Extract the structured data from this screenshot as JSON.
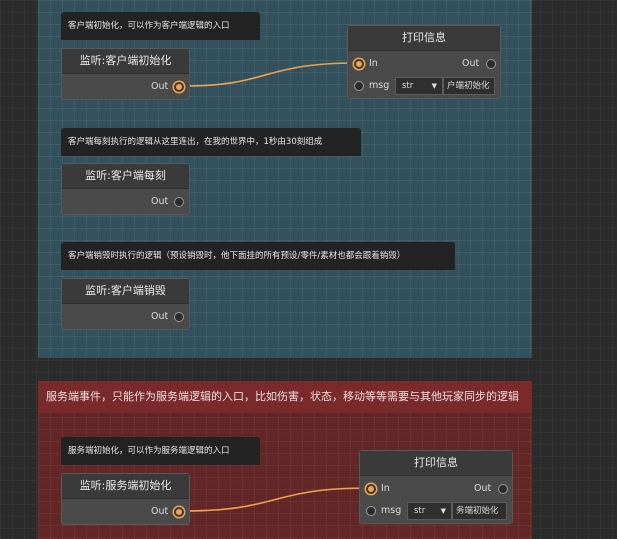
{
  "server_region": {
    "header": "服务端事件，只能作为服务端逻辑的入口，比如伤害，状态，移动等等需要与其他玩家同步的逻辑"
  },
  "comments": {
    "client_init": "客户端初始化，可以作为客户端逻辑的入口",
    "client_tick": "客户端每刻执行的逻辑从这里连出，在我的世界中，1秒由30刻组成",
    "client_destroy": "客户端销毁时执行的逻辑（预设销毁时，他下面挂的所有预设/零件/素材也都会跟着销毁）",
    "server_init": "服务端初始化，可以作为服务端逻辑的入口"
  },
  "nodes": {
    "listen_client_init": {
      "title": "监听:客户端初始化",
      "out_label": "Out"
    },
    "listen_client_tick": {
      "title": "监听:客户端每刻",
      "out_label": "Out"
    },
    "listen_client_destroy": {
      "title": "监听:客户端销毁",
      "out_label": "Out"
    },
    "listen_server_init": {
      "title": "监听:服务端初始化",
      "out_label": "Out"
    },
    "print_client": {
      "title": "打印信息",
      "in_label": "In",
      "out_label": "Out",
      "msg_label": "msg",
      "type": "str",
      "value": "户端初始化"
    },
    "print_server": {
      "title": "打印信息",
      "in_label": "In",
      "out_label": "Out",
      "msg_label": "msg",
      "type": "str",
      "value": "务端初始化"
    }
  },
  "colors": {
    "wire": "#f0a350",
    "client_region": "#346070",
    "server_region": "#702626"
  }
}
